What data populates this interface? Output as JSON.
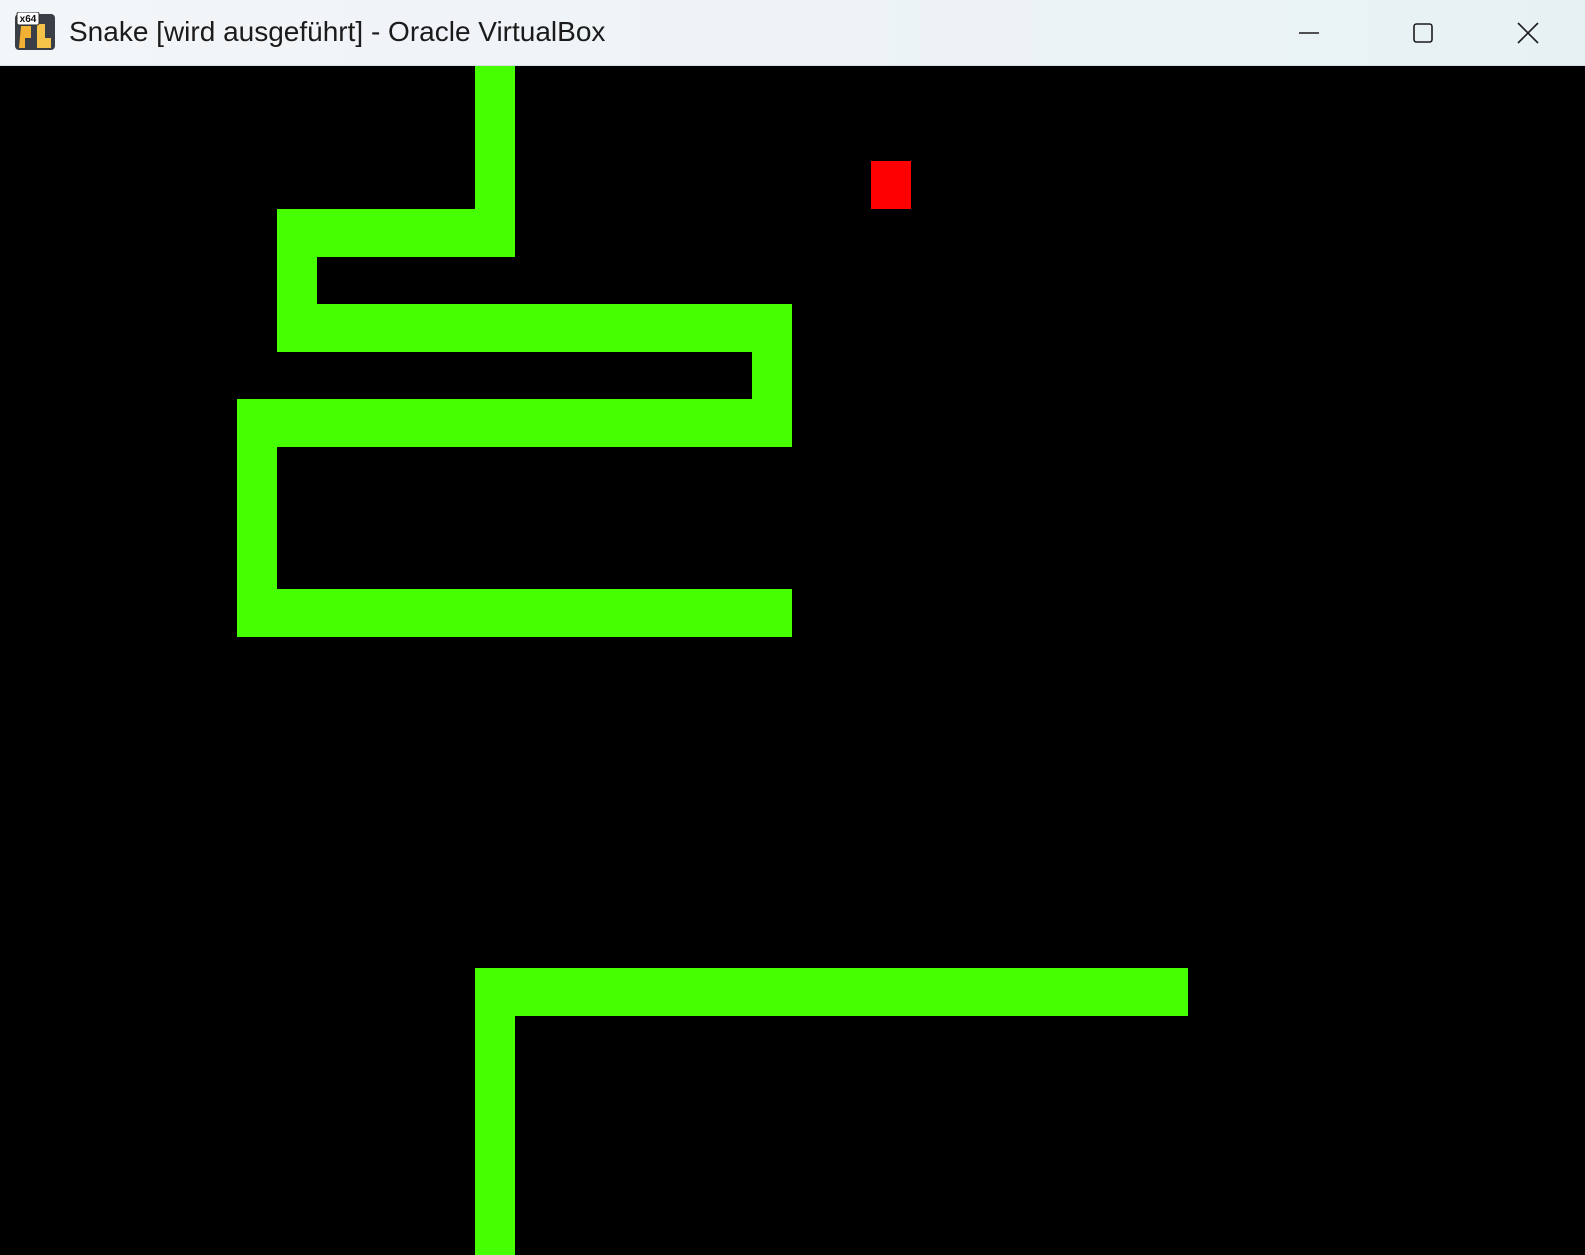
{
  "window": {
    "title": "Snake [wird ausgeführt] - Oracle VirtualBox",
    "app_icon": "virtualbox-x64-icon",
    "app_icon_badge": "x64",
    "controls": {
      "minimize_icon": "minimize-icon",
      "maximize_icon": "maximize-icon",
      "close_icon": "close-icon"
    }
  },
  "game": {
    "name": "Snake",
    "colors": {
      "background": "#000000",
      "snake": "#46ff00",
      "food": "#ff0000"
    }
  }
}
